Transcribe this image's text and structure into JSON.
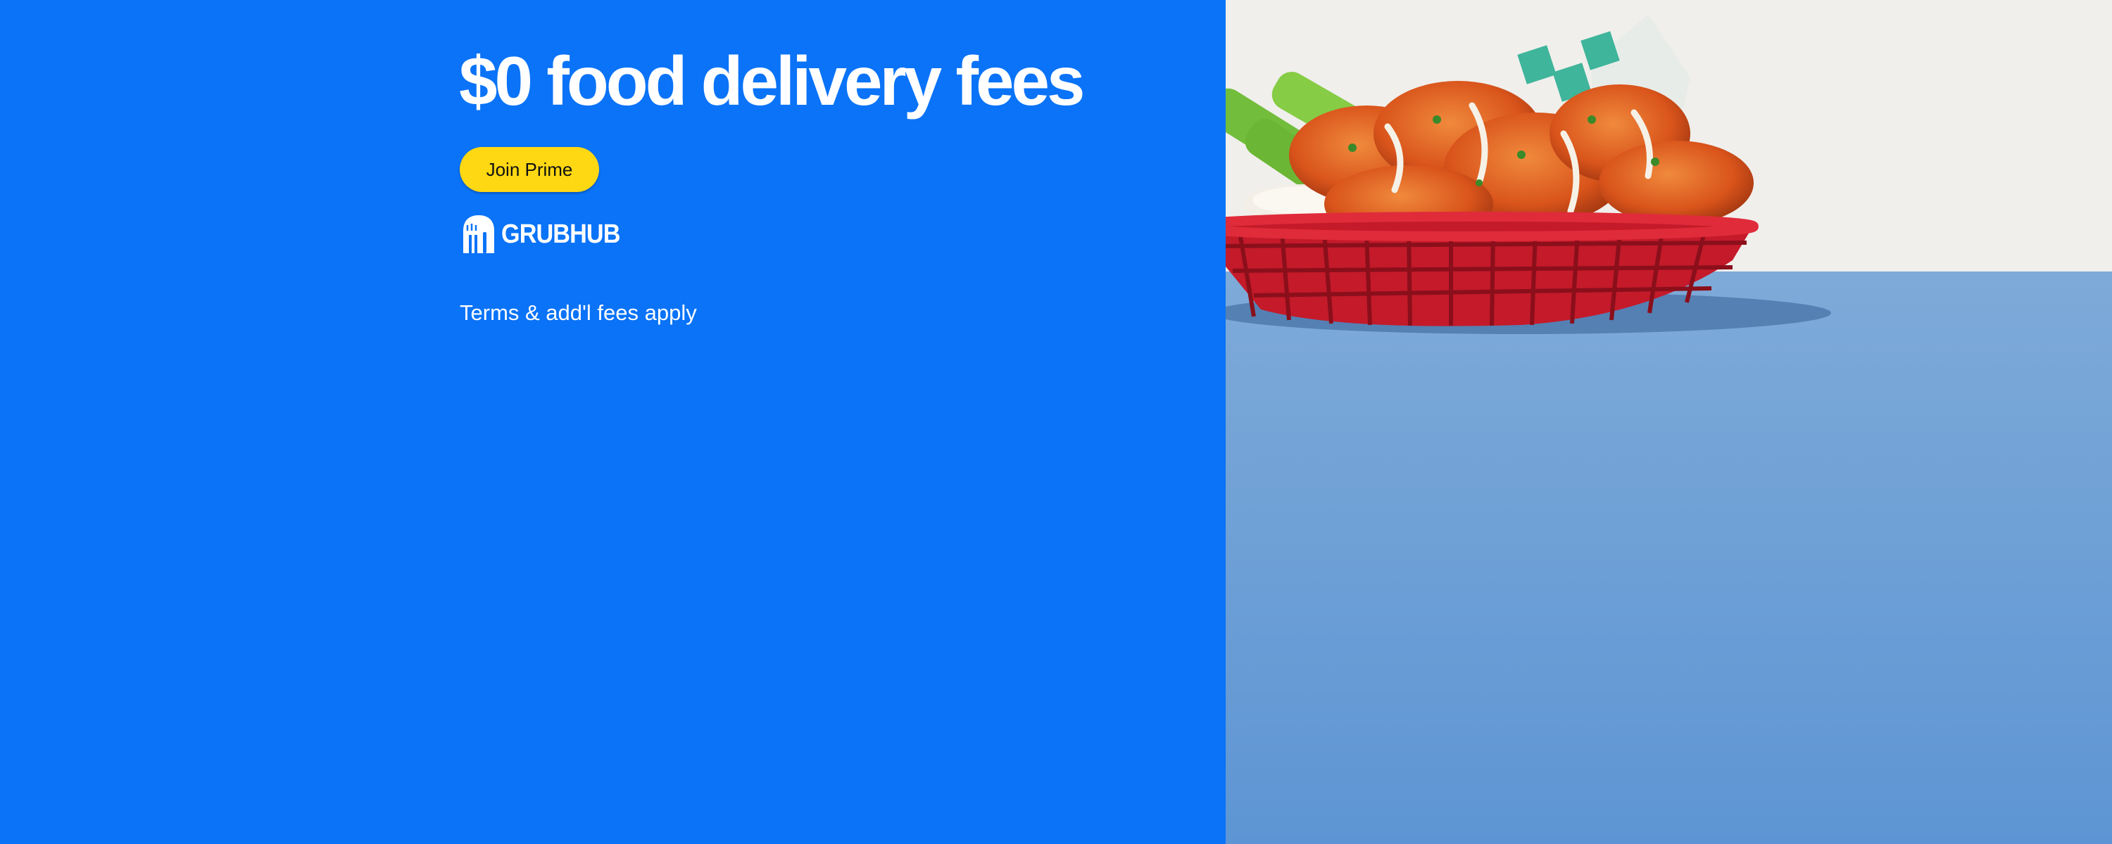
{
  "promo": {
    "headline": "$0 food delivery fees",
    "cta_label": "Join Prime",
    "partner_brand": "GRUBHUB",
    "terms": "Terms & add'l fees apply"
  },
  "image": {
    "subject": "basket-of-buffalo-wings-icon"
  },
  "colors": {
    "background": "#0a73f7",
    "cta": "#ffd814",
    "text": "#ffffff",
    "wall": "#f0efec",
    "table": "#6b9fd6",
    "basket": "#d81f2e",
    "wings": "#e2611e",
    "celery": "#79c13f"
  }
}
